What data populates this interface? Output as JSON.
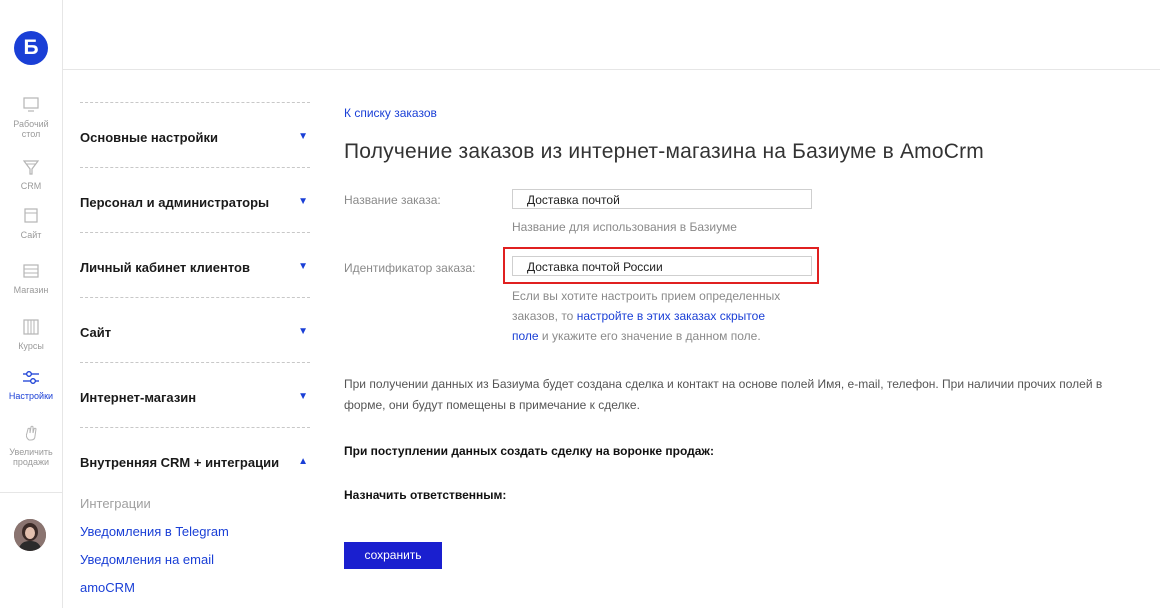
{
  "logo": {
    "letter": "Б"
  },
  "rail": {
    "items": [
      {
        "label_line1": "Рабочий",
        "label_line2": "стол",
        "icon": "desktop-icon"
      },
      {
        "label_line1": "CRM",
        "label_line2": "",
        "icon": "funnel-icon"
      },
      {
        "label_line1": "Сайт",
        "label_line2": "",
        "icon": "site-icon"
      },
      {
        "label_line1": "Магазин",
        "label_line2": "",
        "icon": "shop-icon"
      },
      {
        "label_line1": "Курсы",
        "label_line2": "",
        "icon": "courses-icon"
      },
      {
        "label_line1": "Настройки",
        "label_line2": "",
        "icon": "settings-sliders-icon",
        "active": true
      },
      {
        "label_line1": "Увеличить",
        "label_line2": "продажи",
        "icon": "hand-icon"
      }
    ]
  },
  "menu": {
    "sections": [
      {
        "label": "Основные настройки",
        "arrow": "▼"
      },
      {
        "label": "Персонал и администраторы",
        "arrow": "▼"
      },
      {
        "label": "Личный кабинет клиентов",
        "arrow": "▼"
      },
      {
        "label": "Сайт",
        "arrow": "▼"
      },
      {
        "label": "Интернет-магазин",
        "arrow": "▼"
      },
      {
        "label": "Внутренняя CRM + интеграции",
        "arrow": "▲"
      }
    ],
    "subitems": [
      "Интеграции",
      "Уведомления в Telegram",
      "Уведомления на email",
      "amoCRM"
    ]
  },
  "content": {
    "back_link": "К списку заказов",
    "title": "Получение заказов из интернет-магазина на Базиуме в AmoCrm",
    "order_name": {
      "label": "Название заказа:",
      "value": "Доставка почтой",
      "hint": "Название для использования в Базиуме"
    },
    "order_id": {
      "label": "Идентификатор заказа:",
      "value": "Доставка почтой России",
      "hint_line1": "Если вы хотите настроить прием определенных",
      "hint_line2_pre": "заказов, то ",
      "hint_link_part1": "настройте в этих заказах скрытое",
      "hint_link_part2": "поле",
      "hint_line3_post": " и укажите его значение в данном поле."
    },
    "info_text": "При получении данных из Базиума будет создана сделка и контакт на основе полей Имя, e-mail, телефон. При наличии прочих полей в форме, они будут помещены в примечание к сделке.",
    "funnel_label": "При поступлении данных создать сделку на воронке продаж:",
    "responsible_label": "Назначить ответственным:",
    "save_button": "сохранить"
  },
  "colors": {
    "accent": "#1a3fd6",
    "highlight": "#e02020",
    "button": "#1a1fcf"
  }
}
